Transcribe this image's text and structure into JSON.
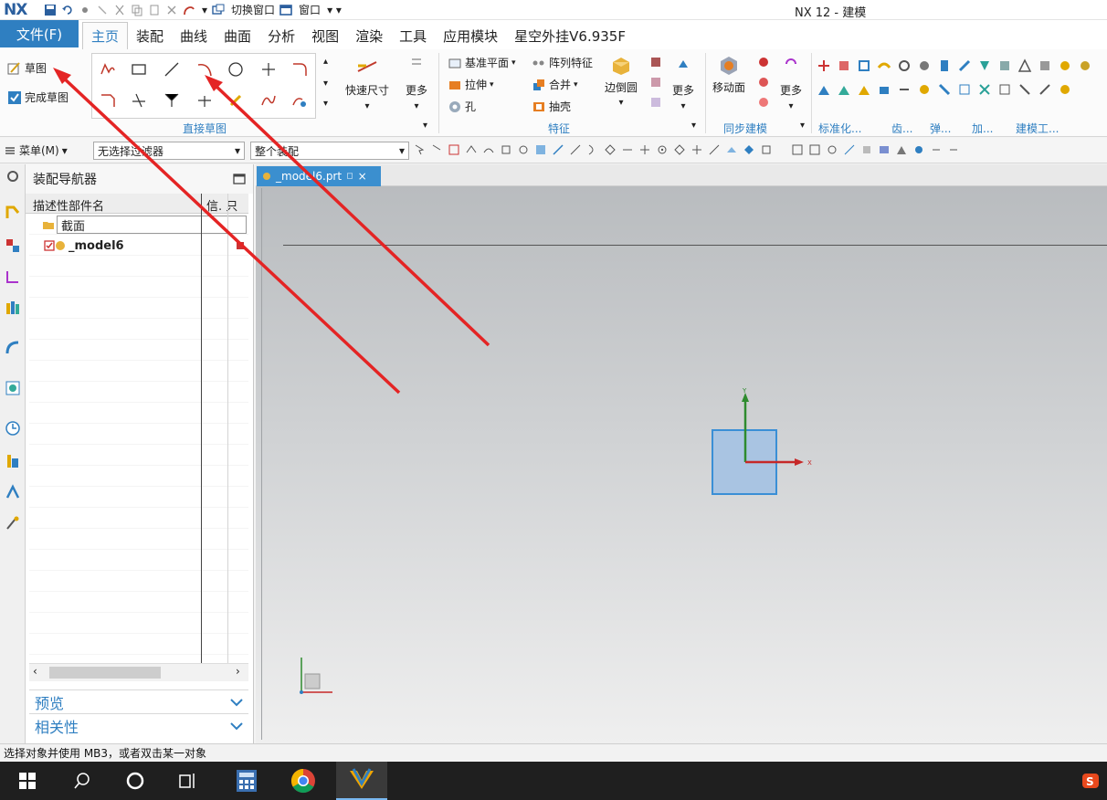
{
  "title": {
    "logo": "NX",
    "quick_switch": "切换窗口",
    "window": "窗口",
    "app_title": "NX 12 - 建模"
  },
  "tabs": {
    "file": "文件(F)",
    "items": [
      "主页",
      "装配",
      "曲线",
      "曲面",
      "分析",
      "视图",
      "渲染",
      "工具",
      "应用模块",
      "星空外挂V6.935F"
    ]
  },
  "ribbon": {
    "sketch": "草图",
    "finish_sketch": "完成草图",
    "direct_sketch": "直接草图",
    "quick_dim": "快速尺寸",
    "more": "更多",
    "datum_plane": "基准平面",
    "pattern_feature": "阵列特征",
    "extrude": "拉伸",
    "unite": "合并",
    "hole": "孔",
    "shell": "抽壳",
    "edge_blend": "边倒圆",
    "feature": "特征",
    "move_face": "移动面",
    "sync_modeling": "同步建模",
    "standardize": "标准化...",
    "gear": "齿...",
    "spring": "弹...",
    "process": "加...",
    "modeling_tools": "建模工..."
  },
  "selbar": {
    "menu": "菜单(M)",
    "filter": "无选择过滤器",
    "scope": "整个装配"
  },
  "navigator": {
    "title": "装配导航器",
    "col_name": "描述性部件名",
    "col_info": "信. 只",
    "row_section": "截面",
    "row_model": "_model6",
    "preview": "预览",
    "dependencies": "相关性"
  },
  "graphics": {
    "file_tab": "_model6.prt"
  },
  "status": {
    "message": "选择对象并使用 MB3，或者双击某一对象"
  },
  "colors": {
    "accent": "#2f7fc1",
    "arrow": "#e42424"
  }
}
